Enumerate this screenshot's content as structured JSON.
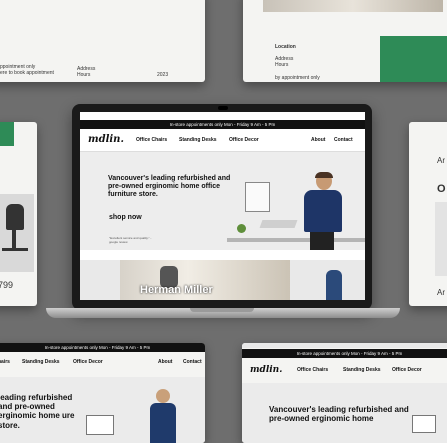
{
  "brand": {
    "logo_text": "mdlin."
  },
  "announcement": "In-store appointments only Mon - Friday 9 Am - 5 Pm",
  "nav": {
    "office_chairs": "Office Chairs",
    "standing_desks": "Standing Desks",
    "office_decor": "Office Decor",
    "about": "About",
    "contact": "Contact"
  },
  "hero": {
    "headline": "Vancouver's leading refurbished and pre-owned erginomic home office furniture store.",
    "cta": "shop now",
    "review": "\"Excellent service and quality.\" - google review"
  },
  "promo_banner": "Herman Miller",
  "card_top_left": {
    "line1": "ppointment only",
    "line2": "ere to book appointment",
    "address_label": "Address",
    "hours_label": "Hours",
    "year": "2023"
  },
  "card_top_right": {
    "location_label": "Location",
    "address_label": "Address",
    "hours_label": "Hours",
    "appointment": "by appointment only"
  },
  "card_mid_left": {
    "price": "799"
  },
  "card_mid_right": {
    "text_top": "Ar",
    "text_mid": "O",
    "text_bottom": "Ar"
  },
  "card_bottom_left": {
    "announcement": "In-store appointments only Mon - Friday 9 Am - 5 Pm",
    "nav_chairs": "hairs",
    "nav_desks": "Standing Desks",
    "nav_decor": "Office Decor",
    "about": "About",
    "contact": "Contact",
    "headline": "leading refurbished and pre-owned erginomic home ure store."
  },
  "card_bottom_right": {
    "announcement": "In-store appointments only Mon - Friday 9 Am - 5 Pm",
    "logo": "mdlin.",
    "nav_chairs": "Office Chairs",
    "nav_desks": "Standing Desks",
    "nav_decor": "Office Decor",
    "headline": "Vancouver's leading refurbished and pre-owned erginomic home"
  },
  "colors": {
    "accent_green": "#2e8b57",
    "background": "#6e6e6e"
  }
}
